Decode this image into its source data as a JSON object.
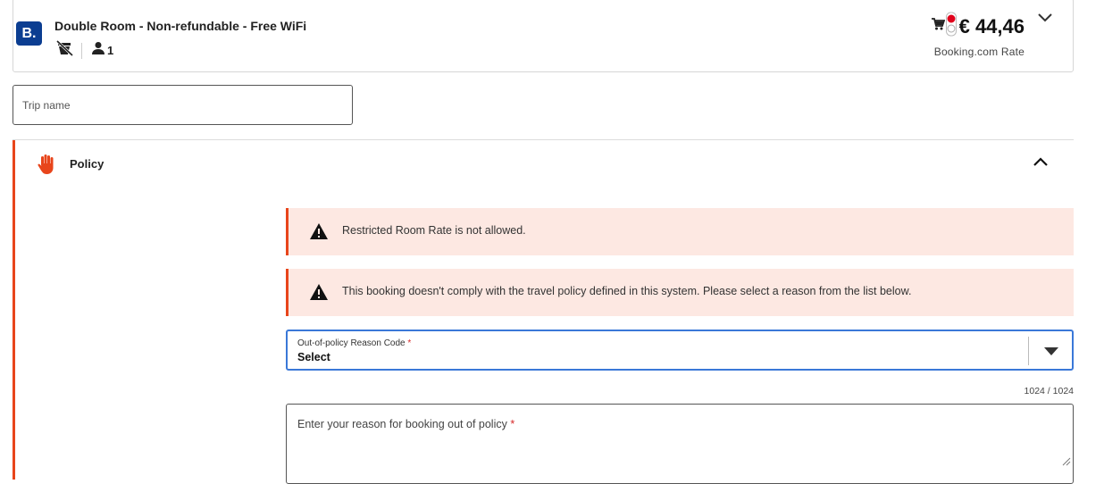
{
  "room": {
    "provider_logo": "B.",
    "title": "Double Room - Non-refundable - Free WiFi",
    "guests": "1",
    "price": "€ 44,46",
    "rate_label": "Booking.com Rate",
    "icons": [
      "no-breakfast-icon",
      "person-icon",
      "cart-icon",
      "traffic-light-icon",
      "chevron-down-icon"
    ]
  },
  "trip": {
    "placeholder": "Trip name",
    "value": ""
  },
  "policy": {
    "title": "Policy",
    "icon": "stop-hand-icon",
    "accent_color": "#e8451b",
    "alerts": [
      "Restricted Room Rate is not allowed.",
      "This booking doesn't comply with the travel policy defined in this system. Please select a reason from the list below."
    ],
    "reason_select": {
      "label": "Out-of-policy Reason Code",
      "required_mark": "*",
      "value": "Select"
    },
    "char_count": "1024 / 1024",
    "reason_text": {
      "placeholder": "Enter your reason for booking out of policy",
      "required_mark": "*",
      "value": ""
    }
  }
}
